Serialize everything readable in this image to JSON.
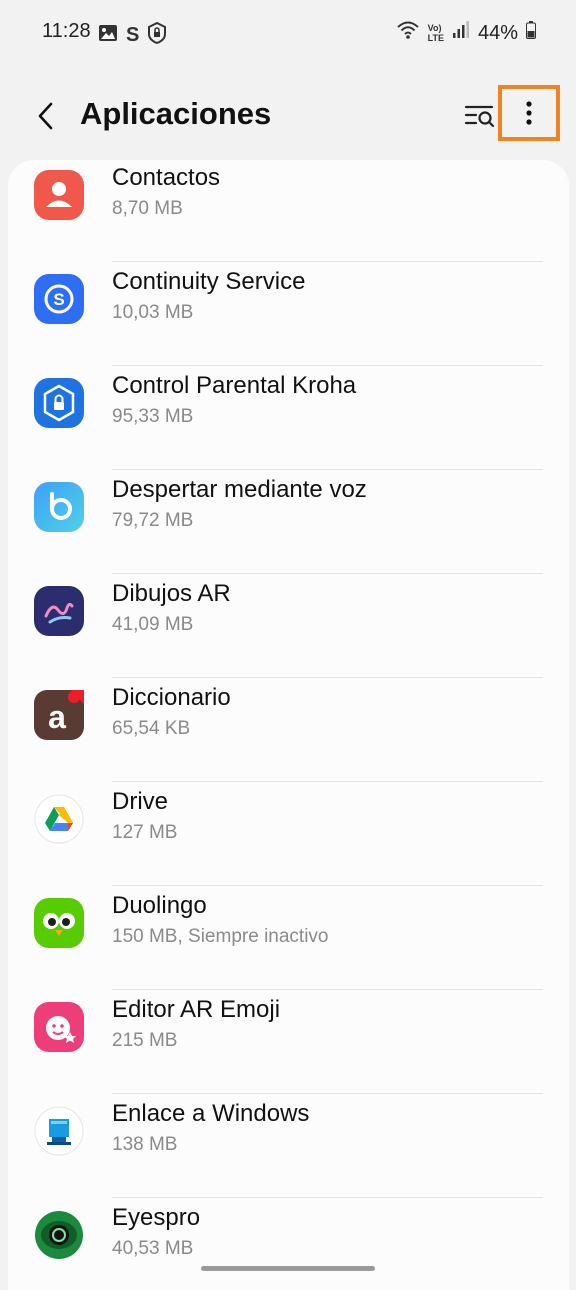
{
  "status_bar": {
    "time": "11:28",
    "battery": "44%",
    "left_icons": [
      "gallery-icon",
      "samsung-s-icon",
      "secure-folder-icon"
    ],
    "right_icons": [
      "wifi-icon",
      "volte-icon",
      "signal-icon",
      "battery-icon"
    ],
    "volte_top": "Vo)",
    "volte_bottom": "LTE",
    "s_letter": "S"
  },
  "header": {
    "title": "Aplicaciones",
    "back_icon": "back-arrow-icon",
    "search_icon": "filter-search-icon",
    "more_icon": "more-options-icon"
  },
  "apps": [
    {
      "name": "Contactos",
      "size": "8,70 MB",
      "icon": "contacts-icon"
    },
    {
      "name": "Continuity Service",
      "size": "10,03 MB",
      "icon": "continuity-service-icon"
    },
    {
      "name": "Control Parental Kroha",
      "size": "95,33 MB",
      "icon": "kroha-icon"
    },
    {
      "name": "Despertar mediante voz",
      "size": "79,72 MB",
      "icon": "bixby-icon"
    },
    {
      "name": "Dibujos AR",
      "size": "41,09 MB",
      "icon": "ar-doodle-icon"
    },
    {
      "name": "Diccionario",
      "size": "65,54 KB",
      "icon": "dictionary-icon",
      "icon_letter": "a"
    },
    {
      "name": "Drive",
      "size": "127 MB",
      "icon": "drive-icon"
    },
    {
      "name": "Duolingo",
      "size": "150 MB, Siempre inactivo",
      "icon": "duolingo-icon"
    },
    {
      "name": "Editor AR Emoji",
      "size": "215 MB",
      "icon": "ar-emoji-icon"
    },
    {
      "name": "Enlace a Windows",
      "size": "138 MB",
      "icon": "link-to-windows-icon"
    },
    {
      "name": "Eyespro",
      "size": "40,53 MB",
      "icon": "eyespro-icon"
    }
  ],
  "colors": {
    "accent_highlight": "#f58220",
    "background": "#f2f2f2",
    "card": "#fcfcfc",
    "secondary_text": "#8a8a8a"
  }
}
